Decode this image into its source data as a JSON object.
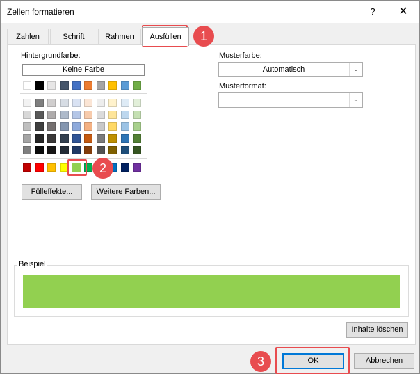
{
  "window": {
    "title": "Zellen formatieren",
    "help_label": "?",
    "close_label": "✕"
  },
  "tabs": [
    {
      "label": "Zahlen"
    },
    {
      "label": "Schrift"
    },
    {
      "label": "Rahmen"
    },
    {
      "label": "Ausfüllen",
      "active": true
    }
  ],
  "background_color": {
    "label": "Hintergrundfarbe:",
    "no_color_label": "Keine Farbe",
    "fill_effects_label": "Fülleffekte...",
    "more_colors_label": "Weitere Farben..."
  },
  "palette": {
    "theme_row": [
      "#ffffff",
      "#000000",
      "#e7e6e6",
      "#44546a",
      "#4472c4",
      "#ed7d31",
      "#a5a5a5",
      "#ffc000",
      "#5b9bd5",
      "#70ad47"
    ],
    "tint_rows": [
      [
        "#f2f2f2",
        "#7f7f7f",
        "#d0cece",
        "#d6dce4",
        "#d9e2f3",
        "#fbe5d5",
        "#ededed",
        "#fff2cc",
        "#deebf6",
        "#e2efd9"
      ],
      [
        "#d8d8d8",
        "#595959",
        "#aeabab",
        "#adb9ca",
        "#b4c6e7",
        "#f7cbac",
        "#dbdbdb",
        "#fee599",
        "#bdd7ee",
        "#c5e0b3"
      ],
      [
        "#bfbfbf",
        "#3f3f3f",
        "#757070",
        "#8496b0",
        "#8eaadb",
        "#f4b183",
        "#c9c9c9",
        "#ffd965",
        "#9cc3e5",
        "#a8d08d"
      ],
      [
        "#a5a5a5",
        "#262626",
        "#3a3838",
        "#323f4f",
        "#2f5496",
        "#c55a11",
        "#7b7b7b",
        "#bf9000",
        "#2e75b5",
        "#538135"
      ],
      [
        "#7f7f7f",
        "#0c0c0c",
        "#171616",
        "#222a35",
        "#1f3864",
        "#833c0b",
        "#525252",
        "#7f6000",
        "#1e4e79",
        "#375623"
      ]
    ],
    "standard_row": [
      "#c00000",
      "#ff0000",
      "#ffc000",
      "#ffff00",
      "#92d050",
      "#00b050",
      "#00b0f0",
      "#0070c0",
      "#002060",
      "#7030a0"
    ]
  },
  "pattern_color": {
    "label": "Musterfarbe:",
    "value": "Automatisch"
  },
  "pattern_style": {
    "label": "Musterformat:",
    "value": ""
  },
  "sample": {
    "label": "Beispiel",
    "color": "#92d050"
  },
  "clear_button": {
    "label": "Inhalte löschen"
  },
  "ok_button": {
    "label": "OK"
  },
  "cancel_button": {
    "label": "Abbrechen"
  },
  "callouts": [
    "1",
    "2",
    "3"
  ],
  "accent_color": "#e84c4f"
}
